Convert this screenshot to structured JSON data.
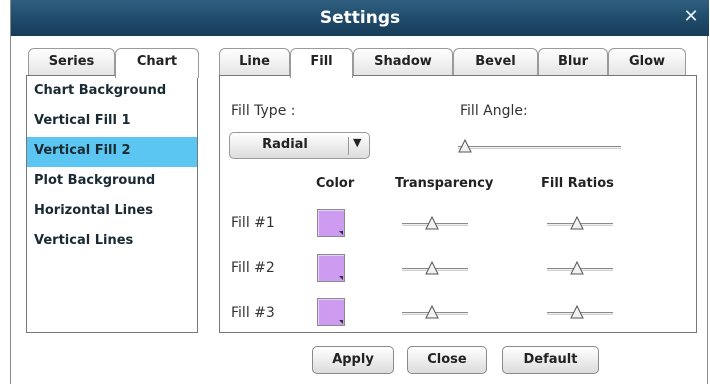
{
  "window": {
    "title": "Settings",
    "close_glyph": "✕"
  },
  "left_tabs": [
    {
      "label": "Series",
      "active": false
    },
    {
      "label": "Chart",
      "active": true
    }
  ],
  "list": {
    "items": [
      {
        "label": "Chart Background",
        "selected": false
      },
      {
        "label": "Vertical Fill 1",
        "selected": false
      },
      {
        "label": "Vertical Fill 2",
        "selected": true
      },
      {
        "label": "Plot Background",
        "selected": false
      },
      {
        "label": "Horizontal Lines",
        "selected": false
      },
      {
        "label": "Vertical Lines",
        "selected": false
      }
    ]
  },
  "right_tabs": [
    {
      "label": "Line",
      "active": false
    },
    {
      "label": "Fill",
      "active": true
    },
    {
      "label": "Shadow",
      "active": false
    },
    {
      "label": "Bevel",
      "active": false
    },
    {
      "label": "Blur",
      "active": false
    },
    {
      "label": "Glow",
      "active": false
    }
  ],
  "fill": {
    "fill_type_label": "Fill Type :",
    "fill_type_value": "Radial",
    "fill_angle_label": "Fill Angle:",
    "fill_angle_value": 0,
    "headers": {
      "color": "Color",
      "transparency": "Transparency",
      "ratios": "Fill Ratios"
    },
    "rows": [
      {
        "label": "Fill #1",
        "color": "#cd9cf0",
        "transparency": 0.45,
        "ratio": 0.45
      },
      {
        "label": "Fill #2",
        "color": "#cd9cf0",
        "transparency": 0.45,
        "ratio": 0.45
      },
      {
        "label": "Fill #3",
        "color": "#cd9cf0",
        "transparency": 0.45,
        "ratio": 0.45
      }
    ]
  },
  "footer": {
    "apply": "Apply",
    "close": "Close",
    "default": "Default"
  },
  "colors": {
    "titlebar": "#1f4a69",
    "selection": "#5bc6f2",
    "swatch": "#cd9cf0"
  }
}
